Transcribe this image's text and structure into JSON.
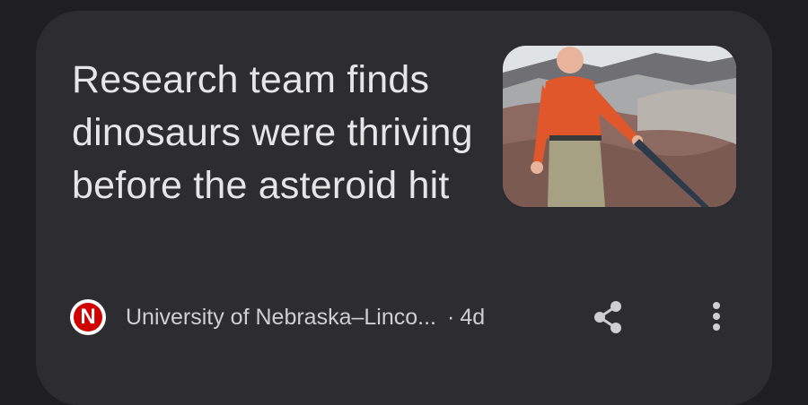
{
  "article": {
    "headline": "Research team finds dinosaurs were thriving before the asteroid hit",
    "image_alt": "man in orange shirt standing in badlands terrain holding a rod"
  },
  "meta": {
    "publisher_logo_letter": "N",
    "publisher": "University of Nebraska–Linco...",
    "separator": "·",
    "age": "4d"
  },
  "icons": {
    "share": "share-icon",
    "more": "more-vert-icon"
  },
  "colors": {
    "background": "#1f1f23",
    "card": "#2c2c31",
    "text": "#e6e6e8",
    "publisher_logo": "#d00000"
  }
}
